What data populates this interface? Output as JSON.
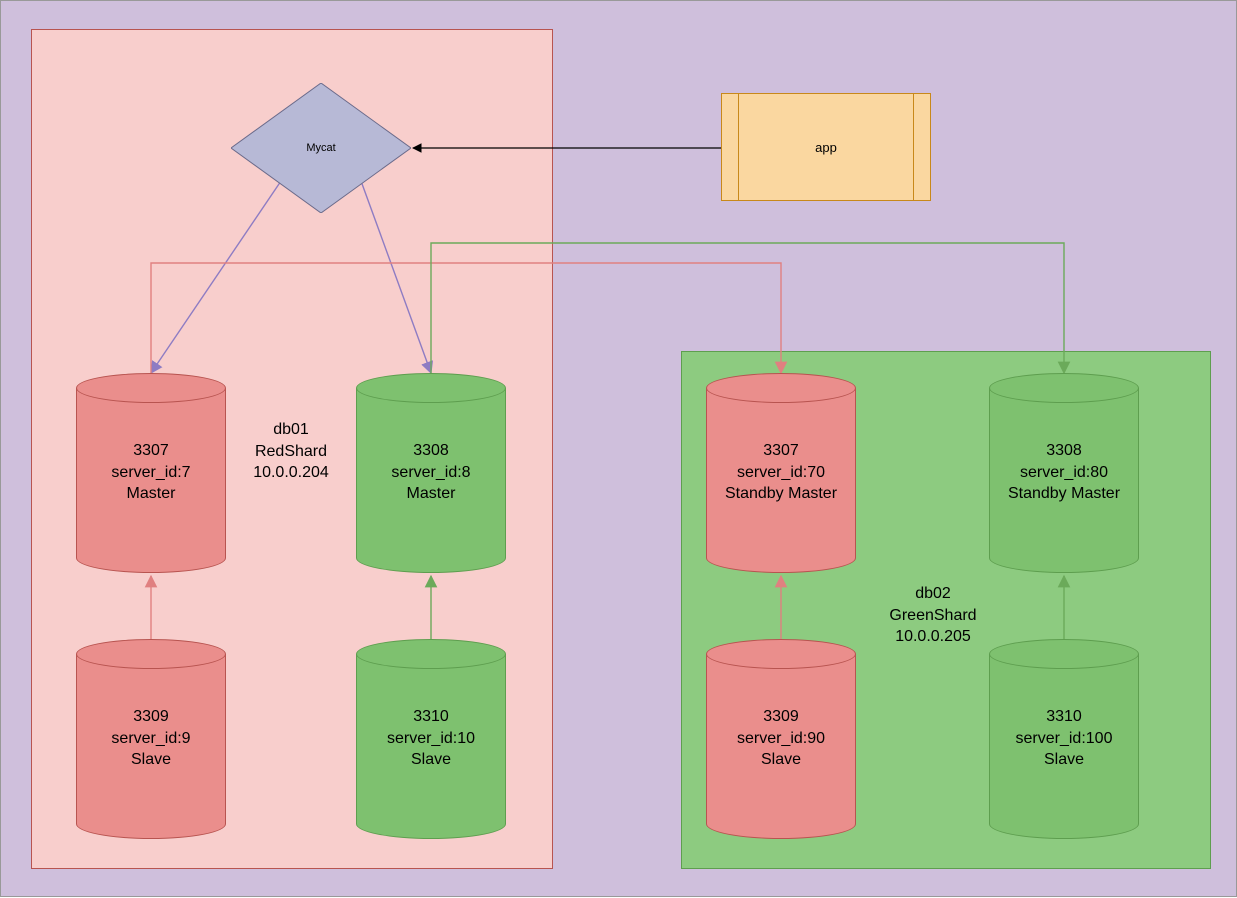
{
  "mycat": {
    "label": "Mycat"
  },
  "app": {
    "label": "app"
  },
  "db01": {
    "name": "db01",
    "shard": "RedShard",
    "ip": "10.0.0.204"
  },
  "db02": {
    "name": "db02",
    "shard": "GreenShard",
    "ip": "10.0.0.205"
  },
  "nodes": {
    "n1": {
      "port": "3307",
      "sid": "server_id:7",
      "role": "Master"
    },
    "n2": {
      "port": "3308",
      "sid": "server_id:8",
      "role": "Master"
    },
    "n3": {
      "port": "3309",
      "sid": "server_id:9",
      "role": "Slave"
    },
    "n4": {
      "port": "3310",
      "sid": "server_id:10",
      "role": "Slave"
    },
    "n5": {
      "port": "3307",
      "sid": "server_id:70",
      "role": "Standby Master"
    },
    "n6": {
      "port": "3308",
      "sid": "server_id:80",
      "role": "Standby Master"
    },
    "n7": {
      "port": "3309",
      "sid": "server_id:90",
      "role": "Slave"
    },
    "n8": {
      "port": "3310",
      "sid": "server_id:100",
      "role": "Slave"
    }
  },
  "colors": {
    "purple_bg": "#CFBFDC",
    "red_region": "#F8CECC",
    "green_region": "#8DCB80",
    "red_cyl": "#EA8E8C",
    "green_cyl": "#7EC16F",
    "app_fill": "#FAD7A0"
  }
}
